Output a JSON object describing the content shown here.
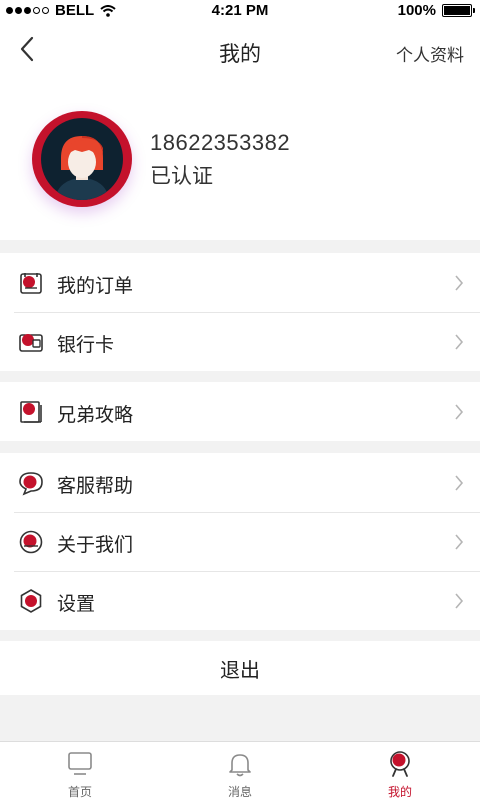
{
  "status_bar": {
    "carrier": "BELL",
    "time": "4:21 PM",
    "battery": "100%"
  },
  "nav": {
    "title": "我的",
    "right_link": "个人资料"
  },
  "profile": {
    "phone": "18622353382",
    "status": "已认证"
  },
  "menu": {
    "orders": "我的订单",
    "bank_card": "银行卡",
    "guide": "兄弟攻略",
    "support": "客服帮助",
    "about": "关于我们",
    "settings": "设置"
  },
  "logout_label": "退出",
  "tabbar": {
    "home": "首页",
    "messages": "消息",
    "mine": "我的"
  },
  "colors": {
    "accent": "#c4122c",
    "background": "#f2f2f2"
  }
}
